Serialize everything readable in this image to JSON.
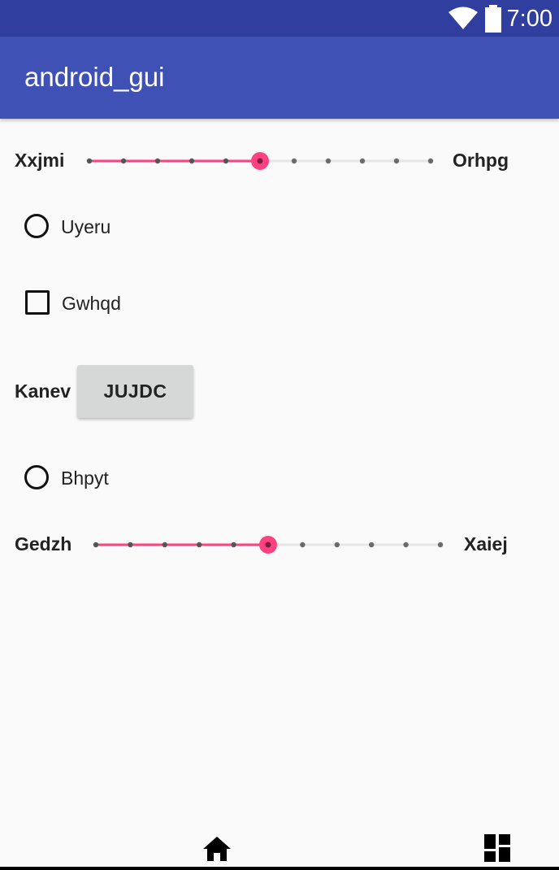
{
  "status_bar": {
    "time": "7:00",
    "icons": [
      "wifi-icon",
      "battery-icon"
    ]
  },
  "app_bar": {
    "title": "android_gui"
  },
  "slider1": {
    "left_label": "Xxjmi",
    "right_label": "Orhpg",
    "steps": 10,
    "value": 5
  },
  "radio1": {
    "label": "Uyeru",
    "checked": false
  },
  "checkbox1": {
    "label": "Gwhqd",
    "checked": false
  },
  "button_row": {
    "label": "Kanev",
    "button_label": "JUJDC"
  },
  "radio2": {
    "label": "Bhpyt",
    "checked": false
  },
  "slider2": {
    "left_label": "Gedzh",
    "right_label": "Xaiej",
    "steps": 10,
    "value": 5
  },
  "nav_bar": {
    "icons": [
      "home-icon",
      "dashboard-icon"
    ]
  },
  "colors": {
    "status_bar": "#303f9f",
    "app_bar": "#3f51b5",
    "accent": "#ff4081",
    "background": "#fafafa"
  }
}
